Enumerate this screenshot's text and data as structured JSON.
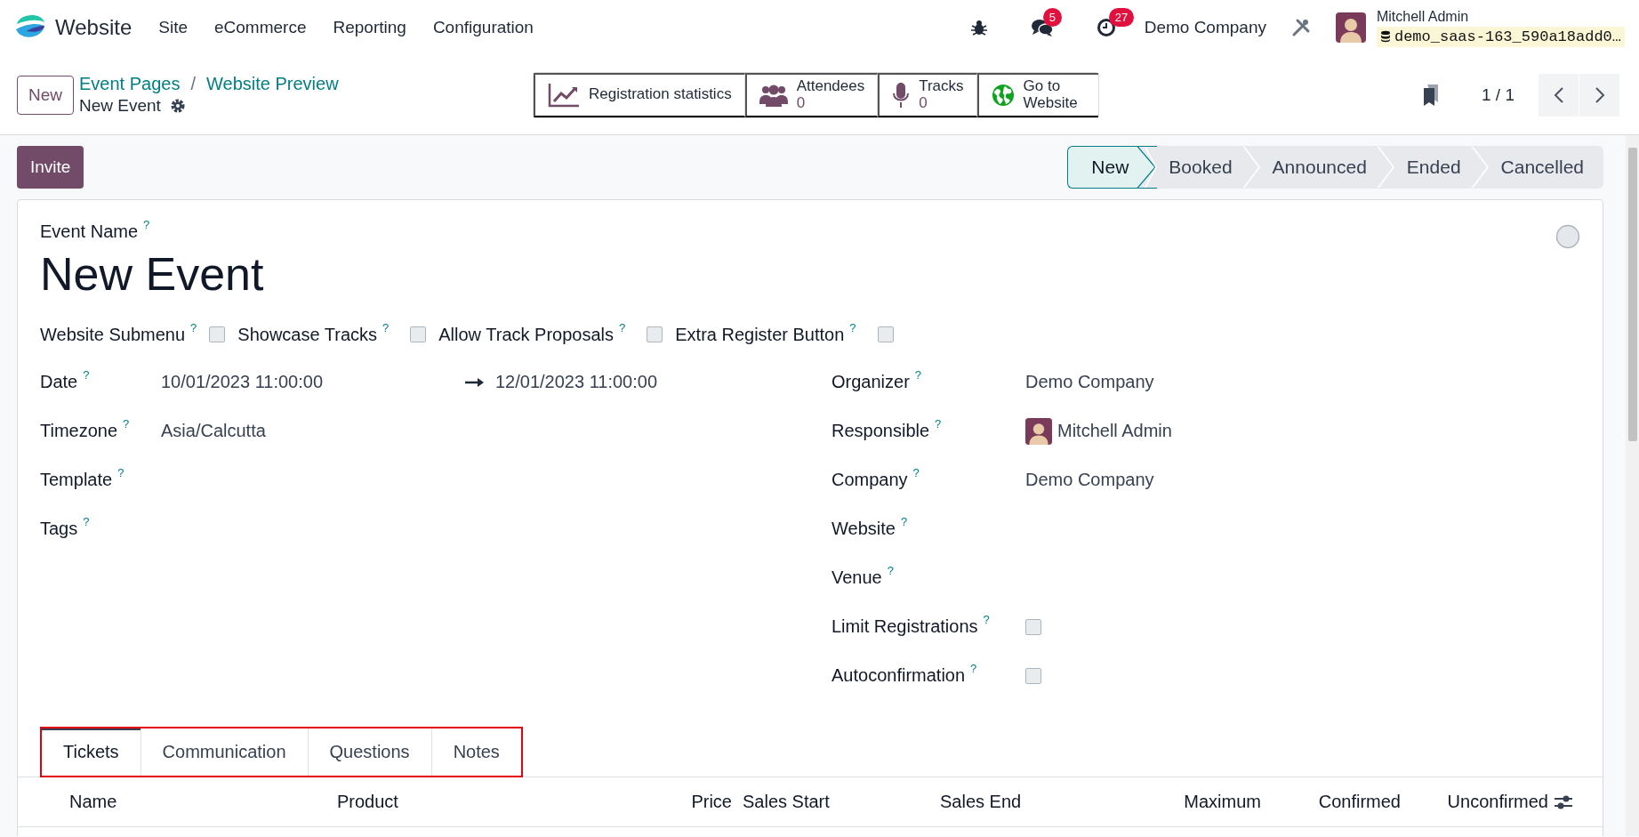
{
  "navbar": {
    "app_name": "Website",
    "menus": [
      "Site",
      "eCommerce",
      "Reporting",
      "Configuration"
    ],
    "messages_badge": "5",
    "activities_badge": "27",
    "company": "Demo Company",
    "user_name": "Mitchell Admin",
    "database": "demo_saas-163_590a18add0…"
  },
  "control_panel": {
    "new_button": "New",
    "breadcrumbs": [
      "Event Pages",
      "Website Preview"
    ],
    "breadcrumb_separator": "/",
    "record_title": "New Event",
    "pager": "1 / 1",
    "smart_buttons": [
      {
        "kind": "chart",
        "label": "Registration statistics"
      },
      {
        "kind": "users",
        "label": "Attendees",
        "value": "0"
      },
      {
        "kind": "microphone",
        "label": "Tracks",
        "value": "0"
      },
      {
        "kind": "globe",
        "label": "Go to Website"
      }
    ]
  },
  "invite_button": "Invite",
  "stages": [
    {
      "label": "New",
      "selected": true
    },
    {
      "label": "Booked",
      "selected": false
    },
    {
      "label": "Announced",
      "selected": false
    },
    {
      "label": "Ended",
      "selected": false
    },
    {
      "label": "Cancelled",
      "selected": false
    }
  ],
  "form": {
    "name_label": "Event Name",
    "name_help": "?",
    "title": "New Event",
    "options": [
      {
        "label": "Website Submenu",
        "help": "?",
        "checked": false
      },
      {
        "label": "Showcase Tracks",
        "help": "?",
        "checked": false
      },
      {
        "label": "Allow Track Proposals",
        "help": "?",
        "checked": false
      },
      {
        "label": "Extra Register Button",
        "help": "?",
        "checked": false
      }
    ],
    "left_fields": [
      {
        "kind": "daterange",
        "label": "Date",
        "help": "?",
        "value": "10/01/2023 11:00:00",
        "end_value": "12/01/2023 11:00:00"
      },
      {
        "kind": "text",
        "label": "Timezone",
        "help": "?",
        "value": "Asia/Calcutta"
      },
      {
        "kind": "text",
        "label": "Template",
        "help": "?"
      },
      {
        "kind": "text",
        "label": "Tags",
        "help": "?"
      }
    ],
    "right_fields": [
      {
        "kind": "text",
        "label": "Organizer",
        "help": "?",
        "value": "Demo Company"
      },
      {
        "kind": "user",
        "label": "Responsible",
        "help": "?",
        "value": "Mitchell Admin"
      },
      {
        "kind": "text",
        "label": "Company",
        "help": "?",
        "value": "Demo Company"
      },
      {
        "kind": "text",
        "label": "Website",
        "help": "?"
      },
      {
        "kind": "text",
        "label": "Venue",
        "help": "?"
      },
      {
        "kind": "checkbox",
        "label": "Limit Registrations",
        "help": "?",
        "checked": false
      },
      {
        "kind": "checkbox",
        "label": "Autoconfirmation",
        "help": "?",
        "checked": false
      }
    ]
  },
  "notebook": {
    "tabs": [
      {
        "label": "Tickets",
        "selected": true
      },
      {
        "label": "Communication",
        "selected": false
      },
      {
        "label": "Questions",
        "selected": false
      },
      {
        "label": "Notes",
        "selected": false
      }
    ],
    "columns": [
      "Name",
      "Product",
      "Price",
      "Sales Start",
      "Sales End",
      "Maximum",
      "Confirmed",
      "Unconfirmed"
    ]
  }
}
